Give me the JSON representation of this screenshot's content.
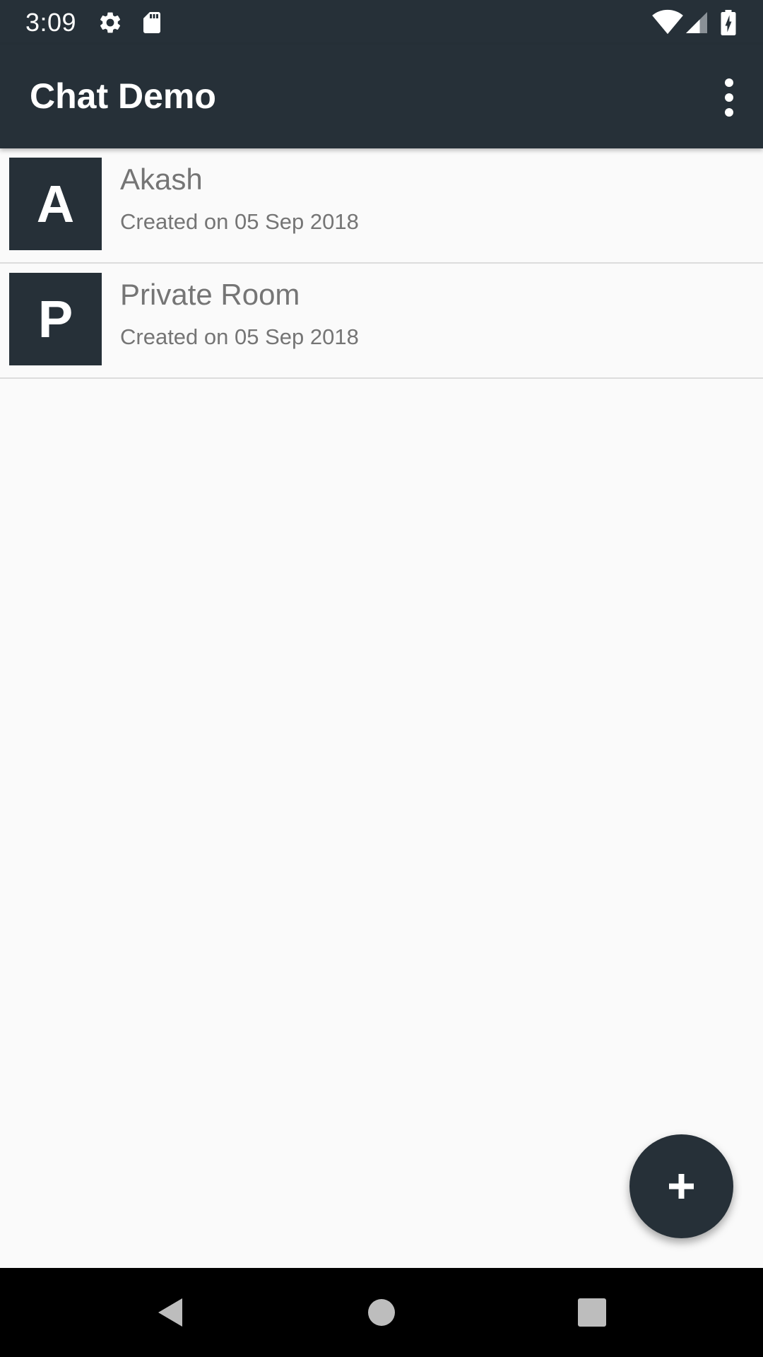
{
  "status_bar": {
    "time": "3:09",
    "icons": [
      "gear-icon",
      "sd-card-icon",
      "wifi-icon",
      "cell-signal-icon",
      "battery-charging-icon"
    ]
  },
  "app_bar": {
    "title": "Chat Demo",
    "menu_icon": "more-vert-icon"
  },
  "rooms": [
    {
      "initial": "A",
      "name": "Akash",
      "created": "Created on 05 Sep 2018"
    },
    {
      "initial": "P",
      "name": "Private Room",
      "created": "Created on 05 Sep 2018"
    }
  ],
  "fab": {
    "icon": "plus-icon"
  },
  "nav_bar": {
    "icons": [
      "back-icon",
      "home-icon",
      "recents-icon"
    ]
  },
  "colors": {
    "primary": "#263038",
    "background": "#fafafa",
    "text_secondary": "#757575",
    "divider": "#dcdcdc"
  }
}
